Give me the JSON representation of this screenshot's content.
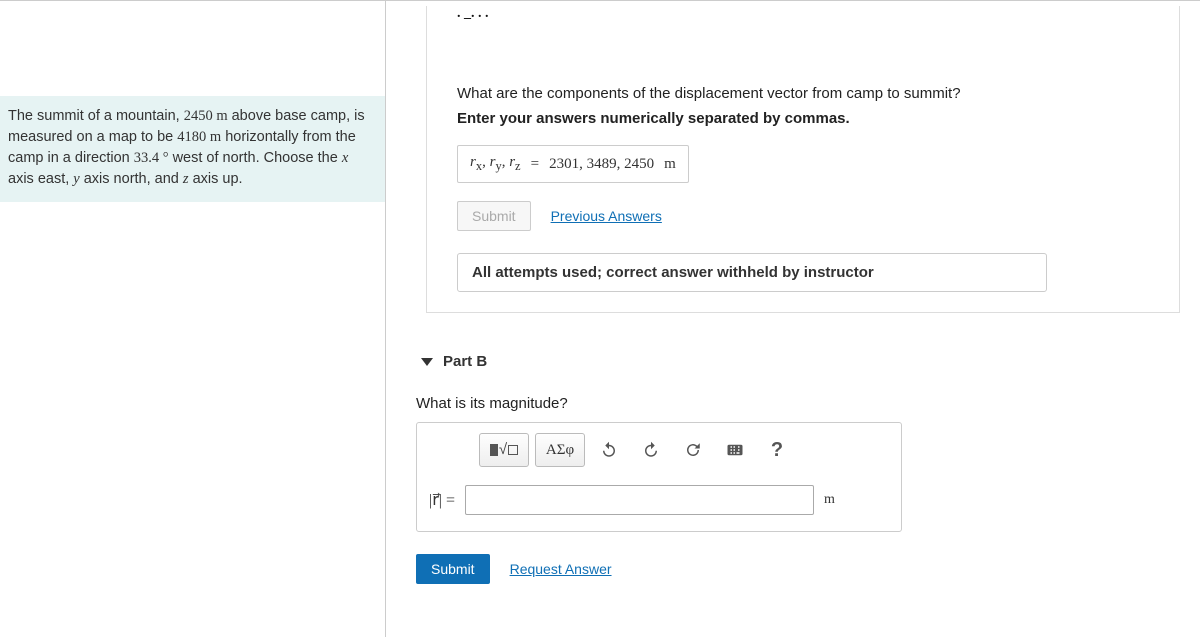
{
  "problem": {
    "text_1": "The summit of a mountain, ",
    "height": "2450",
    "unit_m1": " m",
    "text_2": " above base camp, is measured on a map to be ",
    "dist": "4180",
    "unit_m2": " m",
    "text_3": " horizontally from the camp in a direction ",
    "angle": "33.4",
    "deg": " °",
    "text_4": " west of north. Choose the ",
    "x": "x",
    "text_5": " axis east, ",
    "y": "y",
    "text_6": " axis north, and ",
    "z": "z",
    "text_7": " axis up."
  },
  "partA": {
    "question": "What are the components of the displacement vector from camp to summit?",
    "instruction": "Enter your answers numerically separated by commas.",
    "lhs": "rₓ, rᵧ, r_z",
    "eq": " = ",
    "rhs": "2301, 3489, 2450",
    "unit": " m",
    "submit": "Submit",
    "prev": "Previous Answers",
    "feedback": "All attempts used; correct answer withheld by instructor"
  },
  "partB": {
    "title": "Part B",
    "question": "What is its magnitude?",
    "toolbar": {
      "greek": "ΑΣφ",
      "help": "?"
    },
    "lhs": "|r⃗| = ",
    "unit": "m",
    "submit": "Submit",
    "request": "Request Answer"
  }
}
